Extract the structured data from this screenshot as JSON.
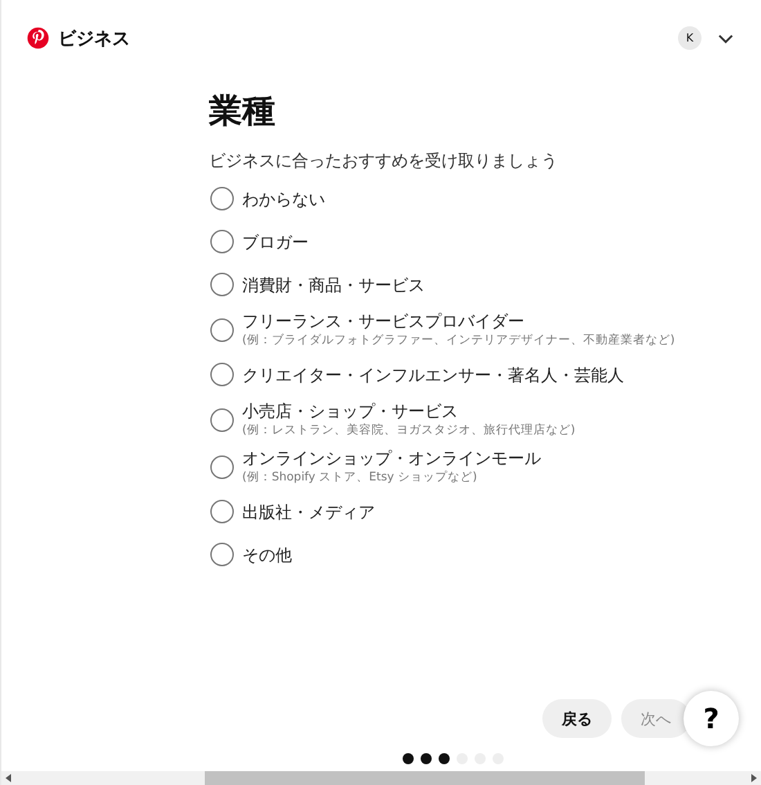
{
  "header": {
    "brand": "ビジネス",
    "avatar": "K"
  },
  "title": "業種",
  "subtitle": "ビジネスに合ったおすすめを受け取りましょう",
  "options": [
    {
      "label": "わからない",
      "selected": false
    },
    {
      "label": "ブロガー",
      "selected": false
    },
    {
      "label": "消費財・商品・サービス",
      "selected": false
    },
    {
      "label": "フリーランス・サービスプロバイダー",
      "hint": "(例：ブライダルフォトグラファー、インテリアデザイナー、不動産業者など)",
      "selected": false
    },
    {
      "label": "クリエイター・インフルエンサー・著名人・芸能人",
      "selected": false
    },
    {
      "label": "小売店・ショップ・サービス",
      "hint": "(例：レストラン、美容院、ヨガスタジオ、旅行代理店など)",
      "selected": false
    },
    {
      "label": "オンラインショップ・オンラインモール",
      "hint": "(例：Shopify ストア、Etsy ショップなど)",
      "selected": false
    },
    {
      "label": "出版社・メディア",
      "selected": false
    },
    {
      "label": "その他",
      "selected": false
    }
  ],
  "buttons": [
    {
      "label": "戻る",
      "disabled": false
    },
    {
      "label": "次へ",
      "disabled": true
    }
  ],
  "help": "?",
  "steps": [
    {
      "done": true
    },
    {
      "done": true
    },
    {
      "done": true
    },
    {
      "done": false
    },
    {
      "done": false
    },
    {
      "done": false
    }
  ]
}
